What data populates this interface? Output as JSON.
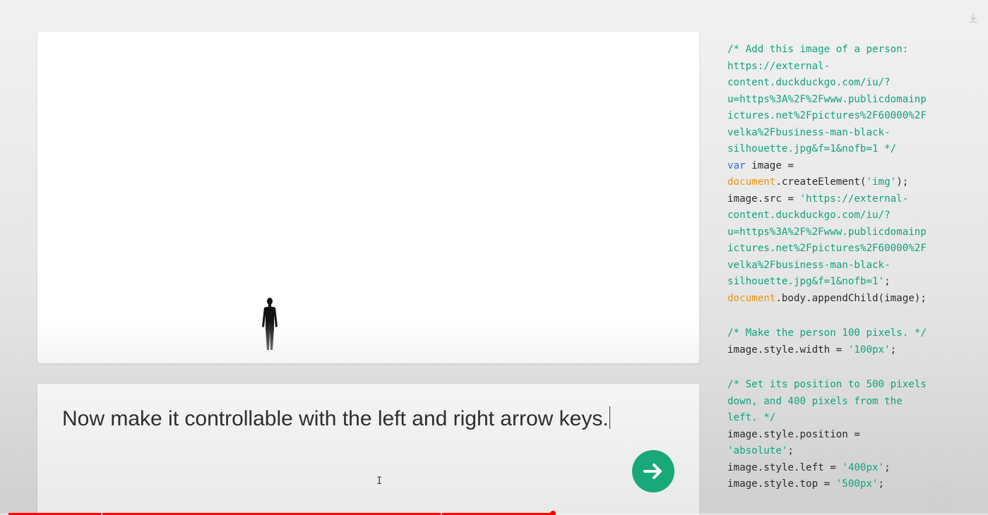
{
  "preview": {
    "image_alt": "business man black silhouette"
  },
  "prompt": {
    "text": "Now make it controllable with the left and right arrow keys.",
    "submit_icon": "arrow-right-icon",
    "submit_color": "#19a87a"
  },
  "code_lines": [
    [
      {
        "t": "comment",
        "v": "/* Add this image of a person:"
      }
    ],
    [
      {
        "t": "comment",
        "v": "https://external-"
      }
    ],
    [
      {
        "t": "comment",
        "v": "content.duckduckgo.com/iu/?"
      }
    ],
    [
      {
        "t": "comment",
        "v": "u=https%3A%2F%2Fwww.publicdomainp"
      }
    ],
    [
      {
        "t": "comment",
        "v": "ictures.net%2Fpictures%2F60000%2F"
      }
    ],
    [
      {
        "t": "comment",
        "v": "velka%2Fbusiness-man-black-"
      }
    ],
    [
      {
        "t": "comment",
        "v": "silhouette.jpg&f=1&nofb=1 */"
      }
    ],
    [
      {
        "t": "keyword",
        "v": "var"
      },
      {
        "t": "plain",
        "v": " image ="
      }
    ],
    [
      {
        "t": "builtin",
        "v": "document"
      },
      {
        "t": "plain",
        "v": ".createElement("
      },
      {
        "t": "string",
        "v": "'img'"
      },
      {
        "t": "plain",
        "v": ");"
      }
    ],
    [
      {
        "t": "plain",
        "v": "image.src = "
      },
      {
        "t": "string",
        "v": "'https://external-"
      }
    ],
    [
      {
        "t": "string",
        "v": "content.duckduckgo.com/iu/?"
      }
    ],
    [
      {
        "t": "string",
        "v": "u=https%3A%2F%2Fwww.publicdomainp"
      }
    ],
    [
      {
        "t": "string",
        "v": "ictures.net%2Fpictures%2F60000%2F"
      }
    ],
    [
      {
        "t": "string",
        "v": "velka%2Fbusiness-man-black-"
      }
    ],
    [
      {
        "t": "string",
        "v": "silhouette.jpg&f=1&nofb=1'"
      },
      {
        "t": "plain",
        "v": ";"
      }
    ],
    [
      {
        "t": "builtin",
        "v": "document"
      },
      {
        "t": "plain",
        "v": ".body.appendChild(image);"
      }
    ],
    [],
    [
      {
        "t": "comment",
        "v": "/* Make the person 100 pixels. */"
      }
    ],
    [
      {
        "t": "plain",
        "v": "image.style.width = "
      },
      {
        "t": "string",
        "v": "'100px'"
      },
      {
        "t": "plain",
        "v": ";"
      }
    ],
    [],
    [
      {
        "t": "comment",
        "v": "/* Set its position to 500 pixels"
      }
    ],
    [
      {
        "t": "comment",
        "v": "down, and 400 pixels from the"
      }
    ],
    [
      {
        "t": "comment",
        "v": "left. */"
      }
    ],
    [
      {
        "t": "plain",
        "v": "image.style.position ="
      }
    ],
    [
      {
        "t": "string",
        "v": "'absolute'"
      },
      {
        "t": "plain",
        "v": ";"
      }
    ],
    [
      {
        "t": "plain",
        "v": "image.style.left = "
      },
      {
        "t": "string",
        "v": "'400px'"
      },
      {
        "t": "plain",
        "v": ";"
      }
    ],
    [
      {
        "t": "plain",
        "v": "image.style.top = "
      },
      {
        "t": "string",
        "v": "'500px'"
      },
      {
        "t": "plain",
        "v": ";"
      }
    ]
  ],
  "icons": {
    "download": "download-icon",
    "logo": "openai-logo-icon",
    "cursor": "text-cursor-icon"
  },
  "video_progress": {
    "played_fraction": 0.56,
    "color": "#ff0000"
  },
  "colors": {
    "comment": "#10a37f",
    "keyword": "#2a6fd6",
    "builtin": "#e69515",
    "string": "#10a37f"
  }
}
